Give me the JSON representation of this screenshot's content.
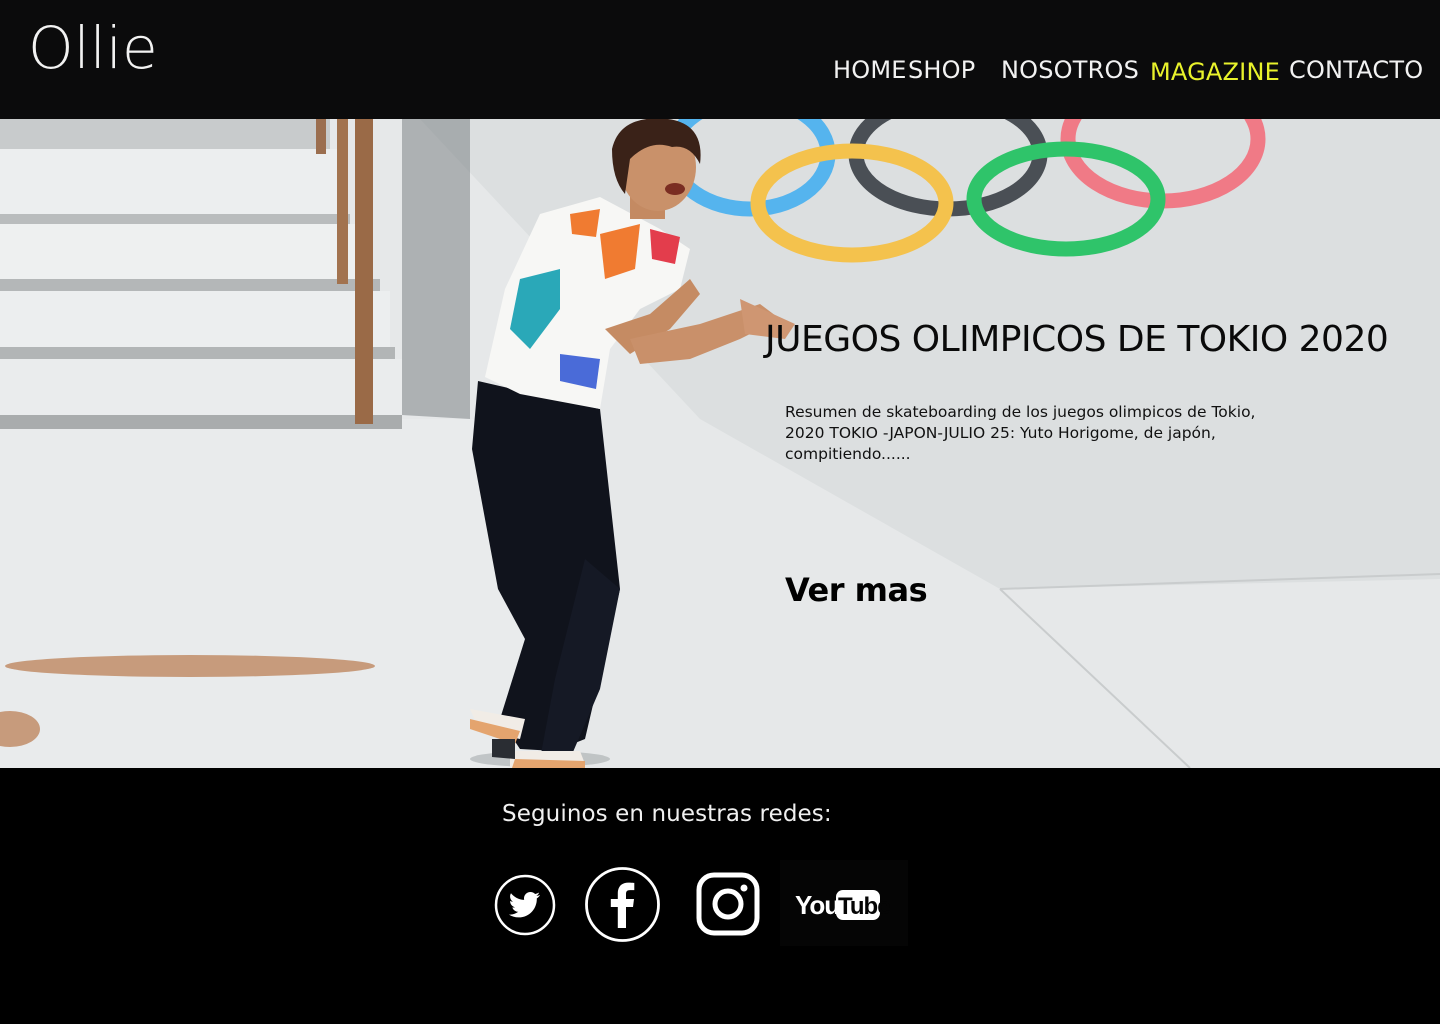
{
  "header": {
    "logo": "Ollie",
    "nav": [
      {
        "label": "HOME"
      },
      {
        "label": "SHOP"
      },
      {
        "label": "NOSOTROS"
      },
      {
        "label": "MAGAZINE",
        "active": true
      },
      {
        "label": "CONTACTO"
      }
    ]
  },
  "hero": {
    "title": "JUEGOS OLIMPICOS DE TOKIO 2020",
    "description": "Resumen de skateboarding de los juegos olimpicos de Tokio, 2020 TOKIO -JAPON-JULIO 25: Yuto Horigome, de japón, compitiendo......",
    "cta": "Ver mas",
    "image": "skateboarder-photo"
  },
  "footer": {
    "follow_text": "Seguinos en nuestras redes:",
    "social": [
      {
        "icon": "twitter-icon"
      },
      {
        "icon": "facebook-icon"
      },
      {
        "icon": "instagram-icon"
      },
      {
        "icon": "youtube-icon",
        "text": "YouTube"
      }
    ]
  },
  "colors": {
    "header_bg": "#0b0b0c",
    "active_nav": "#e8f22b",
    "footer_bg": "#000000",
    "text_light": "#f2f2f2"
  }
}
